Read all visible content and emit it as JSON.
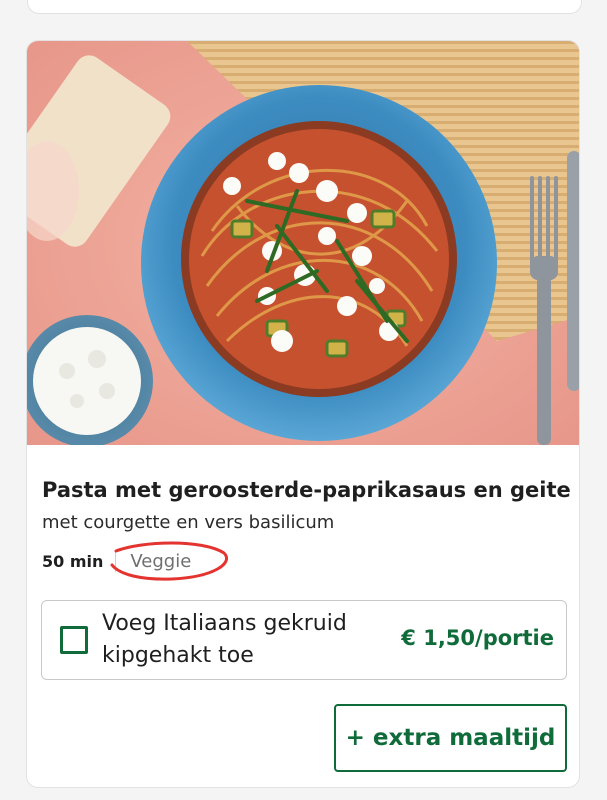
{
  "recipe": {
    "title": "Pasta met geroosterde-paprikasaus en geite..",
    "subtitle": "met courgette en vers basilicum",
    "time": "50 min",
    "tag": "Veggie",
    "image_alt": "recipe-photo-pasta"
  },
  "addon": {
    "label": "Voeg Italiaans gekruid kipgehakt toe",
    "price": "€ 1,50/portie",
    "checked": false
  },
  "actions": {
    "extra_meal_label": "+ extra maaltijd"
  },
  "colors": {
    "brand_green": "#0f6b3a",
    "annotation_red": "#e3342f",
    "background_pink": "#f0a695",
    "bowl_blue": "#3f8fc4"
  }
}
